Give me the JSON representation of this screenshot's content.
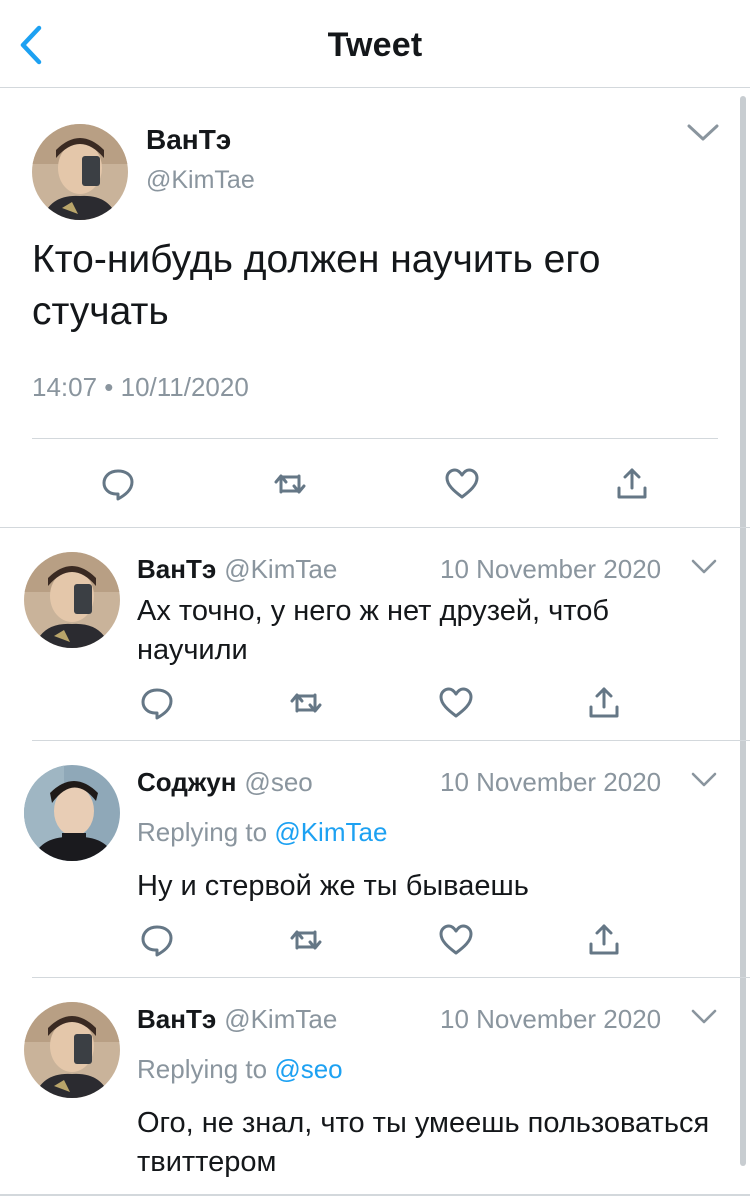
{
  "nav": {
    "title": "Tweet",
    "back_icon": "chevron-left-icon"
  },
  "main_tweet": {
    "name": "ВанТэ",
    "handle": "@KimTae",
    "text": "Кто-нибудь должен научить его стучать",
    "meta": "14:07 • 10/11/2020"
  },
  "replies": [
    {
      "name": "ВанТэ",
      "handle": "@KimTae",
      "date": "10 November 2020",
      "replying_prefix": "",
      "replying_to": "",
      "text": "Ах точно, у него ж нет друзей, чтоб научили"
    },
    {
      "name": "Соджун",
      "handle": "@seo",
      "date": "10 November 2020",
      "replying_prefix": "Replying to ",
      "replying_to": "@KimTae",
      "text": "Ну и стервой же ты бываешь"
    },
    {
      "name": "ВанТэ",
      "handle": "@KimTae",
      "date": "10 November 2020",
      "replying_prefix": "Replying to ",
      "replying_to": "@seo",
      "text": "Ого, не знал, что ты умеешь пользоваться твиттером"
    }
  ],
  "colors": {
    "accent": "#1da1f2",
    "muted": "#8a959e",
    "icon": "#657786",
    "divider": "#d3d8dc"
  }
}
